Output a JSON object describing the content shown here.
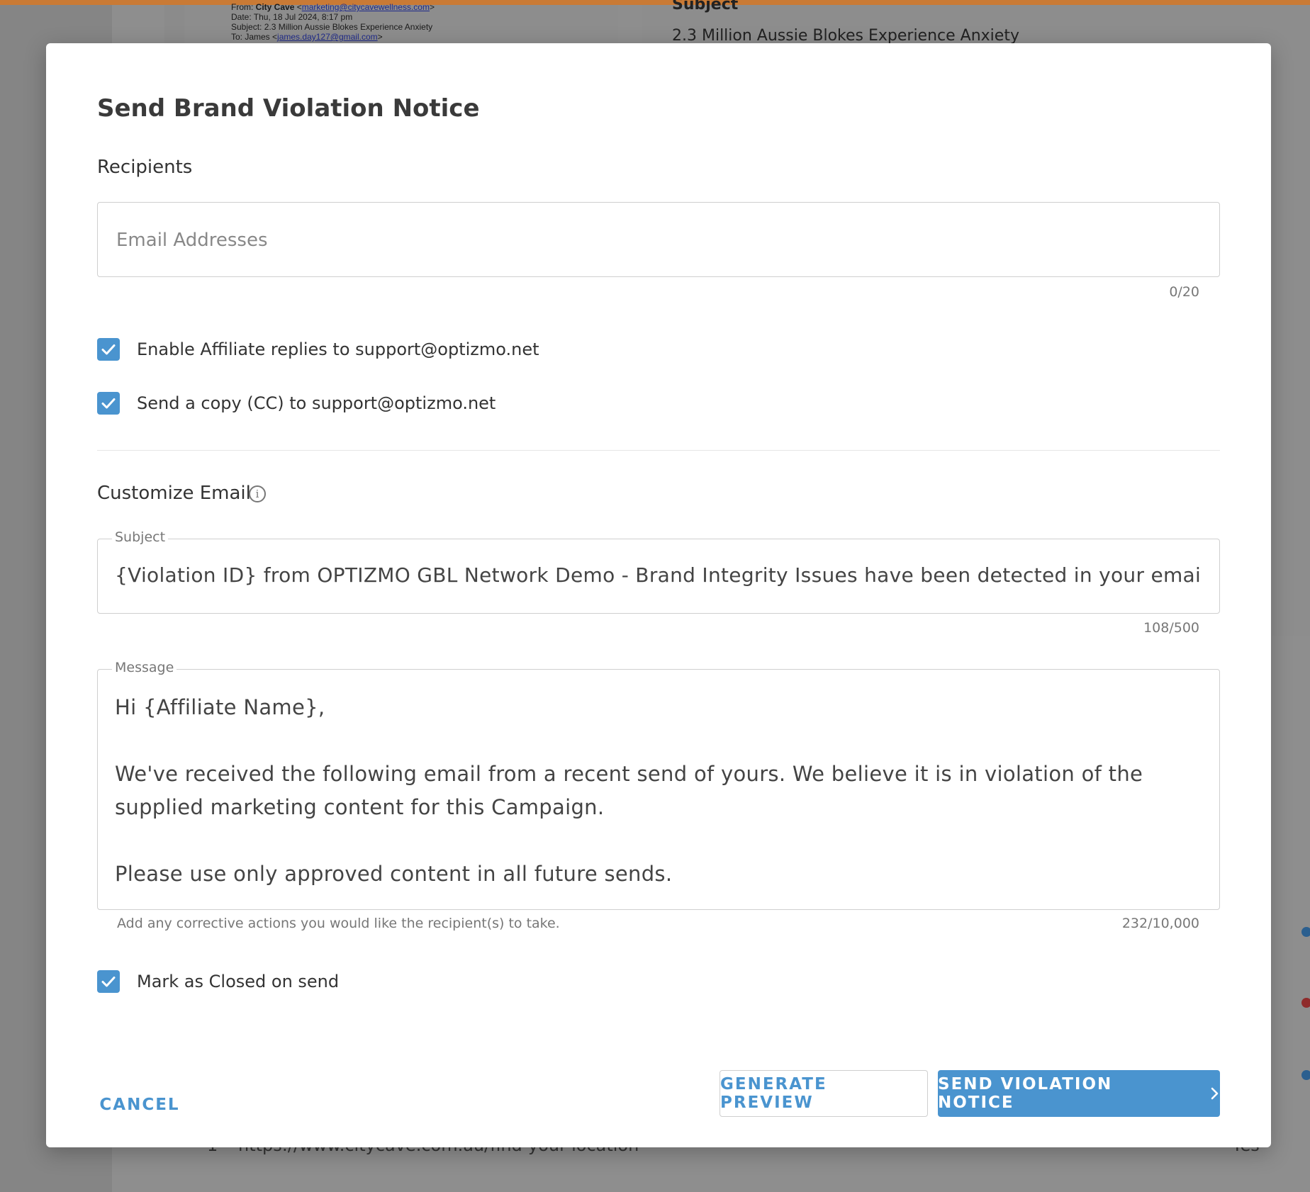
{
  "background": {
    "email_header": {
      "from_prefix": "From: ",
      "from_name": "City Cave",
      "from_email": "marketing@citycavewellness.com",
      "date": "Date: Thu, 18 Jul 2024, 8:17 pm",
      "subject": "Subject: 2.3 Million Aussie Blokes Experience Anxiety",
      "to_prefix": "To: James ",
      "to_email": "james.day127@gmail.com"
    },
    "subject_label": "Subject",
    "subject_value": "2.3 Million Aussie Blokes Experience Anxiety",
    "bottom_row": {
      "url": "https://www.citycave.com.au/find-your-location",
      "yes": "Yes"
    }
  },
  "modal": {
    "title": "Send Brand Violation Notice",
    "recipients": {
      "label": "Recipients",
      "placeholder": "Email Addresses",
      "value": "",
      "counter": "0/20"
    },
    "options": {
      "enable_replies_label": "Enable Affiliate replies to support@optizmo.net",
      "enable_replies_checked": true,
      "send_copy_label": "Send a copy (CC) to support@optizmo.net",
      "send_copy_checked": true
    },
    "customize": {
      "label": "Customize Email",
      "subject_label": "Subject",
      "subject_value": "{Violation ID} from OPTIZMO GBL Network Demo - Brand Integrity Issues have been detected in your email s",
      "subject_counter": "108/500",
      "message_label": "Message",
      "message_value": "Hi {Affiliate Name},\n\nWe've received the following email from a recent send of yours. We believe it is in violation of the supplied marketing content for this Campaign.\n\nPlease use only approved content in all future sends.",
      "message_helper": "Add any corrective actions you would like the recipient(s) to take.",
      "message_counter": "232/10,000"
    },
    "mark_closed": {
      "label": "Mark as Closed on send",
      "checked": true
    },
    "actions": {
      "cancel": "CANCEL",
      "preview": "GENERATE PREVIEW",
      "send": "SEND VIOLATION NOTICE"
    }
  },
  "colors": {
    "accent": "#4a94cf",
    "top_bar": "#c97a35"
  }
}
